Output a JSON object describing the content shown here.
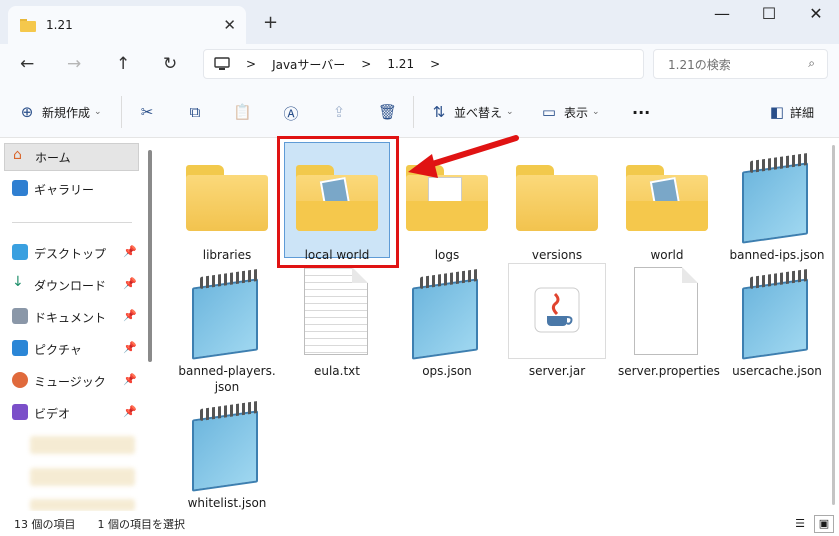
{
  "tab": {
    "title": "1.21",
    "close": "✕",
    "new": "+"
  },
  "window_controls": {
    "minimize": "—",
    "maximize": "☐",
    "close": "✕"
  },
  "nav": {
    "back": "←",
    "forward": "→",
    "up": "↑",
    "refresh": "↻"
  },
  "breadcrumb": {
    "sep": ">",
    "items": [
      "Javaサーバー",
      "1.21"
    ]
  },
  "search": {
    "placeholder": "1.21の検索",
    "icon": "⌕"
  },
  "toolbar": {
    "new_label": "新規作成",
    "sort_label": "並べ替え",
    "view_label": "表示",
    "more": "···",
    "details_label": "詳細",
    "icons": {
      "new": "⊕",
      "cut": "✂",
      "copy": "⧉",
      "paste": "📋",
      "rename": "Ⓐ",
      "share": "⇪",
      "delete": "🗑",
      "sort": "⇅",
      "view": "▭",
      "details": "◧"
    }
  },
  "sidebar": {
    "items": [
      {
        "label": "ホーム",
        "icon": "home-icon"
      },
      {
        "label": "ギャラリー",
        "icon": "gallery-icon"
      },
      {
        "label": "デスクトップ",
        "icon": "desktop-icon"
      },
      {
        "label": "ダウンロード",
        "icon": "download-icon"
      },
      {
        "label": "ドキュメント",
        "icon": "documents-icon"
      },
      {
        "label": "ピクチャ",
        "icon": "pictures-icon"
      },
      {
        "label": "ミュージック",
        "icon": "music-icon"
      },
      {
        "label": "ビデオ",
        "icon": "videos-icon"
      }
    ],
    "pin": "📌"
  },
  "files": [
    {
      "name": "libraries",
      "kind": "folder"
    },
    {
      "name": "local world",
      "kind": "folder-world",
      "selected": true
    },
    {
      "name": "logs",
      "kind": "folder-docs"
    },
    {
      "name": "versions",
      "kind": "folder"
    },
    {
      "name": "world",
      "kind": "folder-world"
    },
    {
      "name": "banned-ips.json",
      "kind": "notepad"
    },
    {
      "name": "banned-players.json",
      "kind": "notepad"
    },
    {
      "name": "eula.txt",
      "kind": "text"
    },
    {
      "name": "ops.json",
      "kind": "notepad"
    },
    {
      "name": "server.jar",
      "kind": "jar"
    },
    {
      "name": "server.properties",
      "kind": "blank"
    },
    {
      "name": "usercache.json",
      "kind": "notepad"
    },
    {
      "name": "whitelist.json",
      "kind": "notepad"
    }
  ],
  "status": {
    "count": "13 個の項目",
    "selected": "1 個の項目を選択"
  },
  "colors": {
    "accent": "#0067c0",
    "highlight": "#e01313",
    "selection": "#cce4f7"
  }
}
